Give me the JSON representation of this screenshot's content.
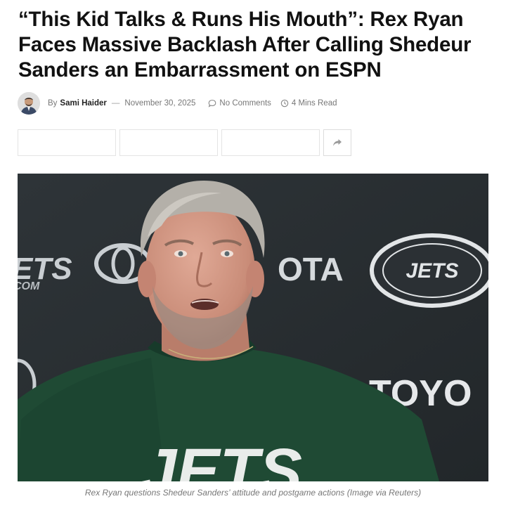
{
  "article": {
    "title": "“This Kid Talks & Runs His Mouth”: Rex Ryan Faces Massive Backlash After Calling Shedeur Sanders an Embarrassment on ESPN",
    "by_label": "By",
    "author": "Sami Haider",
    "separator": "—",
    "date": "November 30, 2025",
    "comments": "No Comments",
    "read_time": "4 Mins Read"
  },
  "share": {
    "buttons": [
      "",
      "",
      ""
    ],
    "more_icon": "share-arrow-icon"
  },
  "image": {
    "caption": "Rex Ryan questions Shedeur Sanders’ attitude and postgame actions (Image via Reuters)",
    "background_text": {
      "left": "ETS",
      "left2": "COM",
      "middle": "OTA",
      "lower": "TOYO",
      "oval": "JETS",
      "shirt": "JETS"
    }
  },
  "colors": {
    "jets_green": "#1f4a34",
    "backdrop": "#2a2f33",
    "text": "#111111",
    "meta": "#777777"
  }
}
